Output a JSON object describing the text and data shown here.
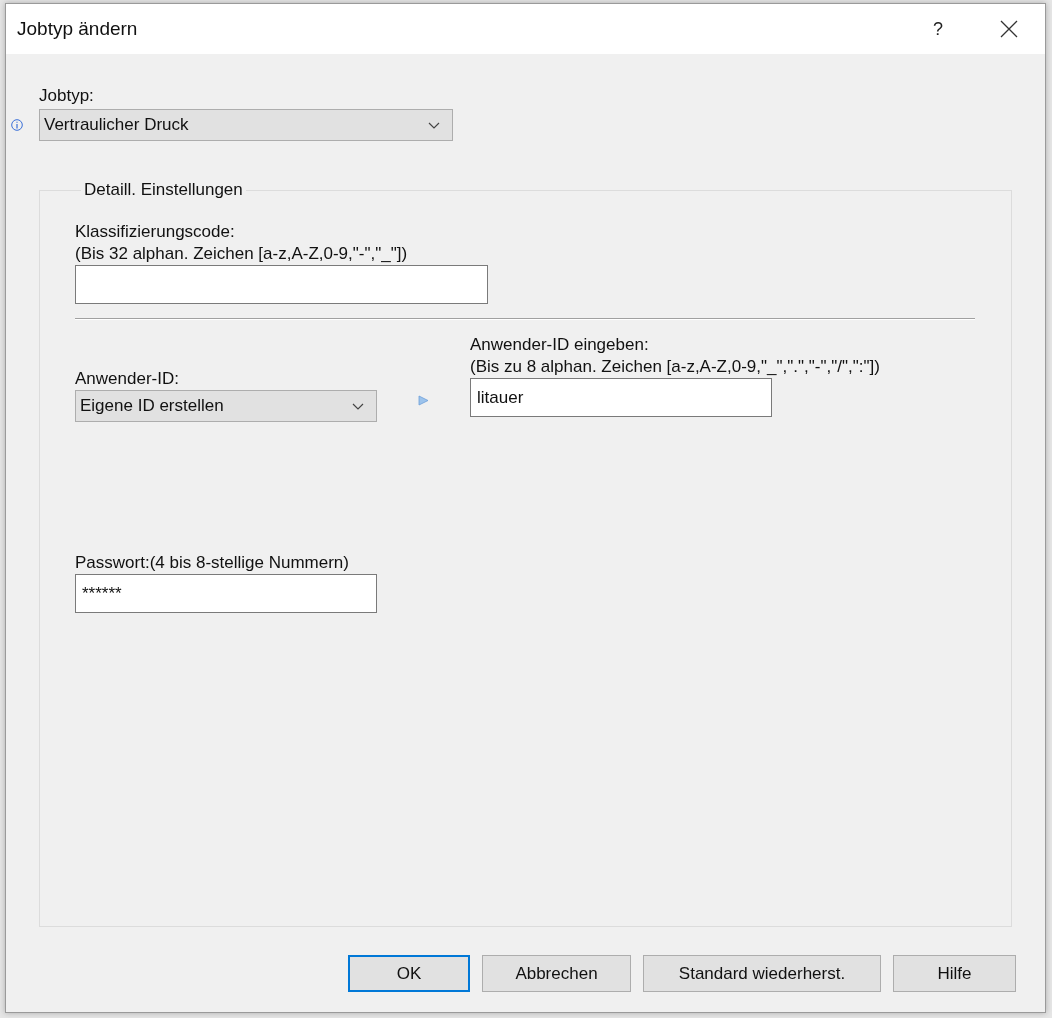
{
  "window": {
    "title": "Jobtyp ändern",
    "help_button": "?"
  },
  "jobtype": {
    "label": "Jobtyp:",
    "value": "Vertraulicher Druck"
  },
  "details": {
    "legend": "Detaill. Einstellungen",
    "classification": {
      "label": "Klassifizierungscode:",
      "hint": "(Bis 32 alphan. Zeichen [a-z,A-Z,0-9,\"-\",\"_\"])"
    },
    "user_id": {
      "label": "Anwender-ID:",
      "value": "Eigene ID erstellen"
    },
    "user_id_input": {
      "label": "Anwender-ID eingeben:",
      "hint": "(Bis zu 8 alphan. Zeichen [a-z,A-Z,0-9,\"_\",\".\",\"-\",\"/\",\":\"])",
      "value": "litauer"
    },
    "password": {
      "label": "Passwort:(4 bis 8-stellige Nummern)",
      "value": "******"
    }
  },
  "buttons": [
    {
      "label": "OK",
      "default": true
    },
    {
      "label": "Abbrechen",
      "default": false
    },
    {
      "label": "Standard wiederherst.",
      "default": false
    },
    {
      "label": "Hilfe",
      "default": false
    }
  ]
}
